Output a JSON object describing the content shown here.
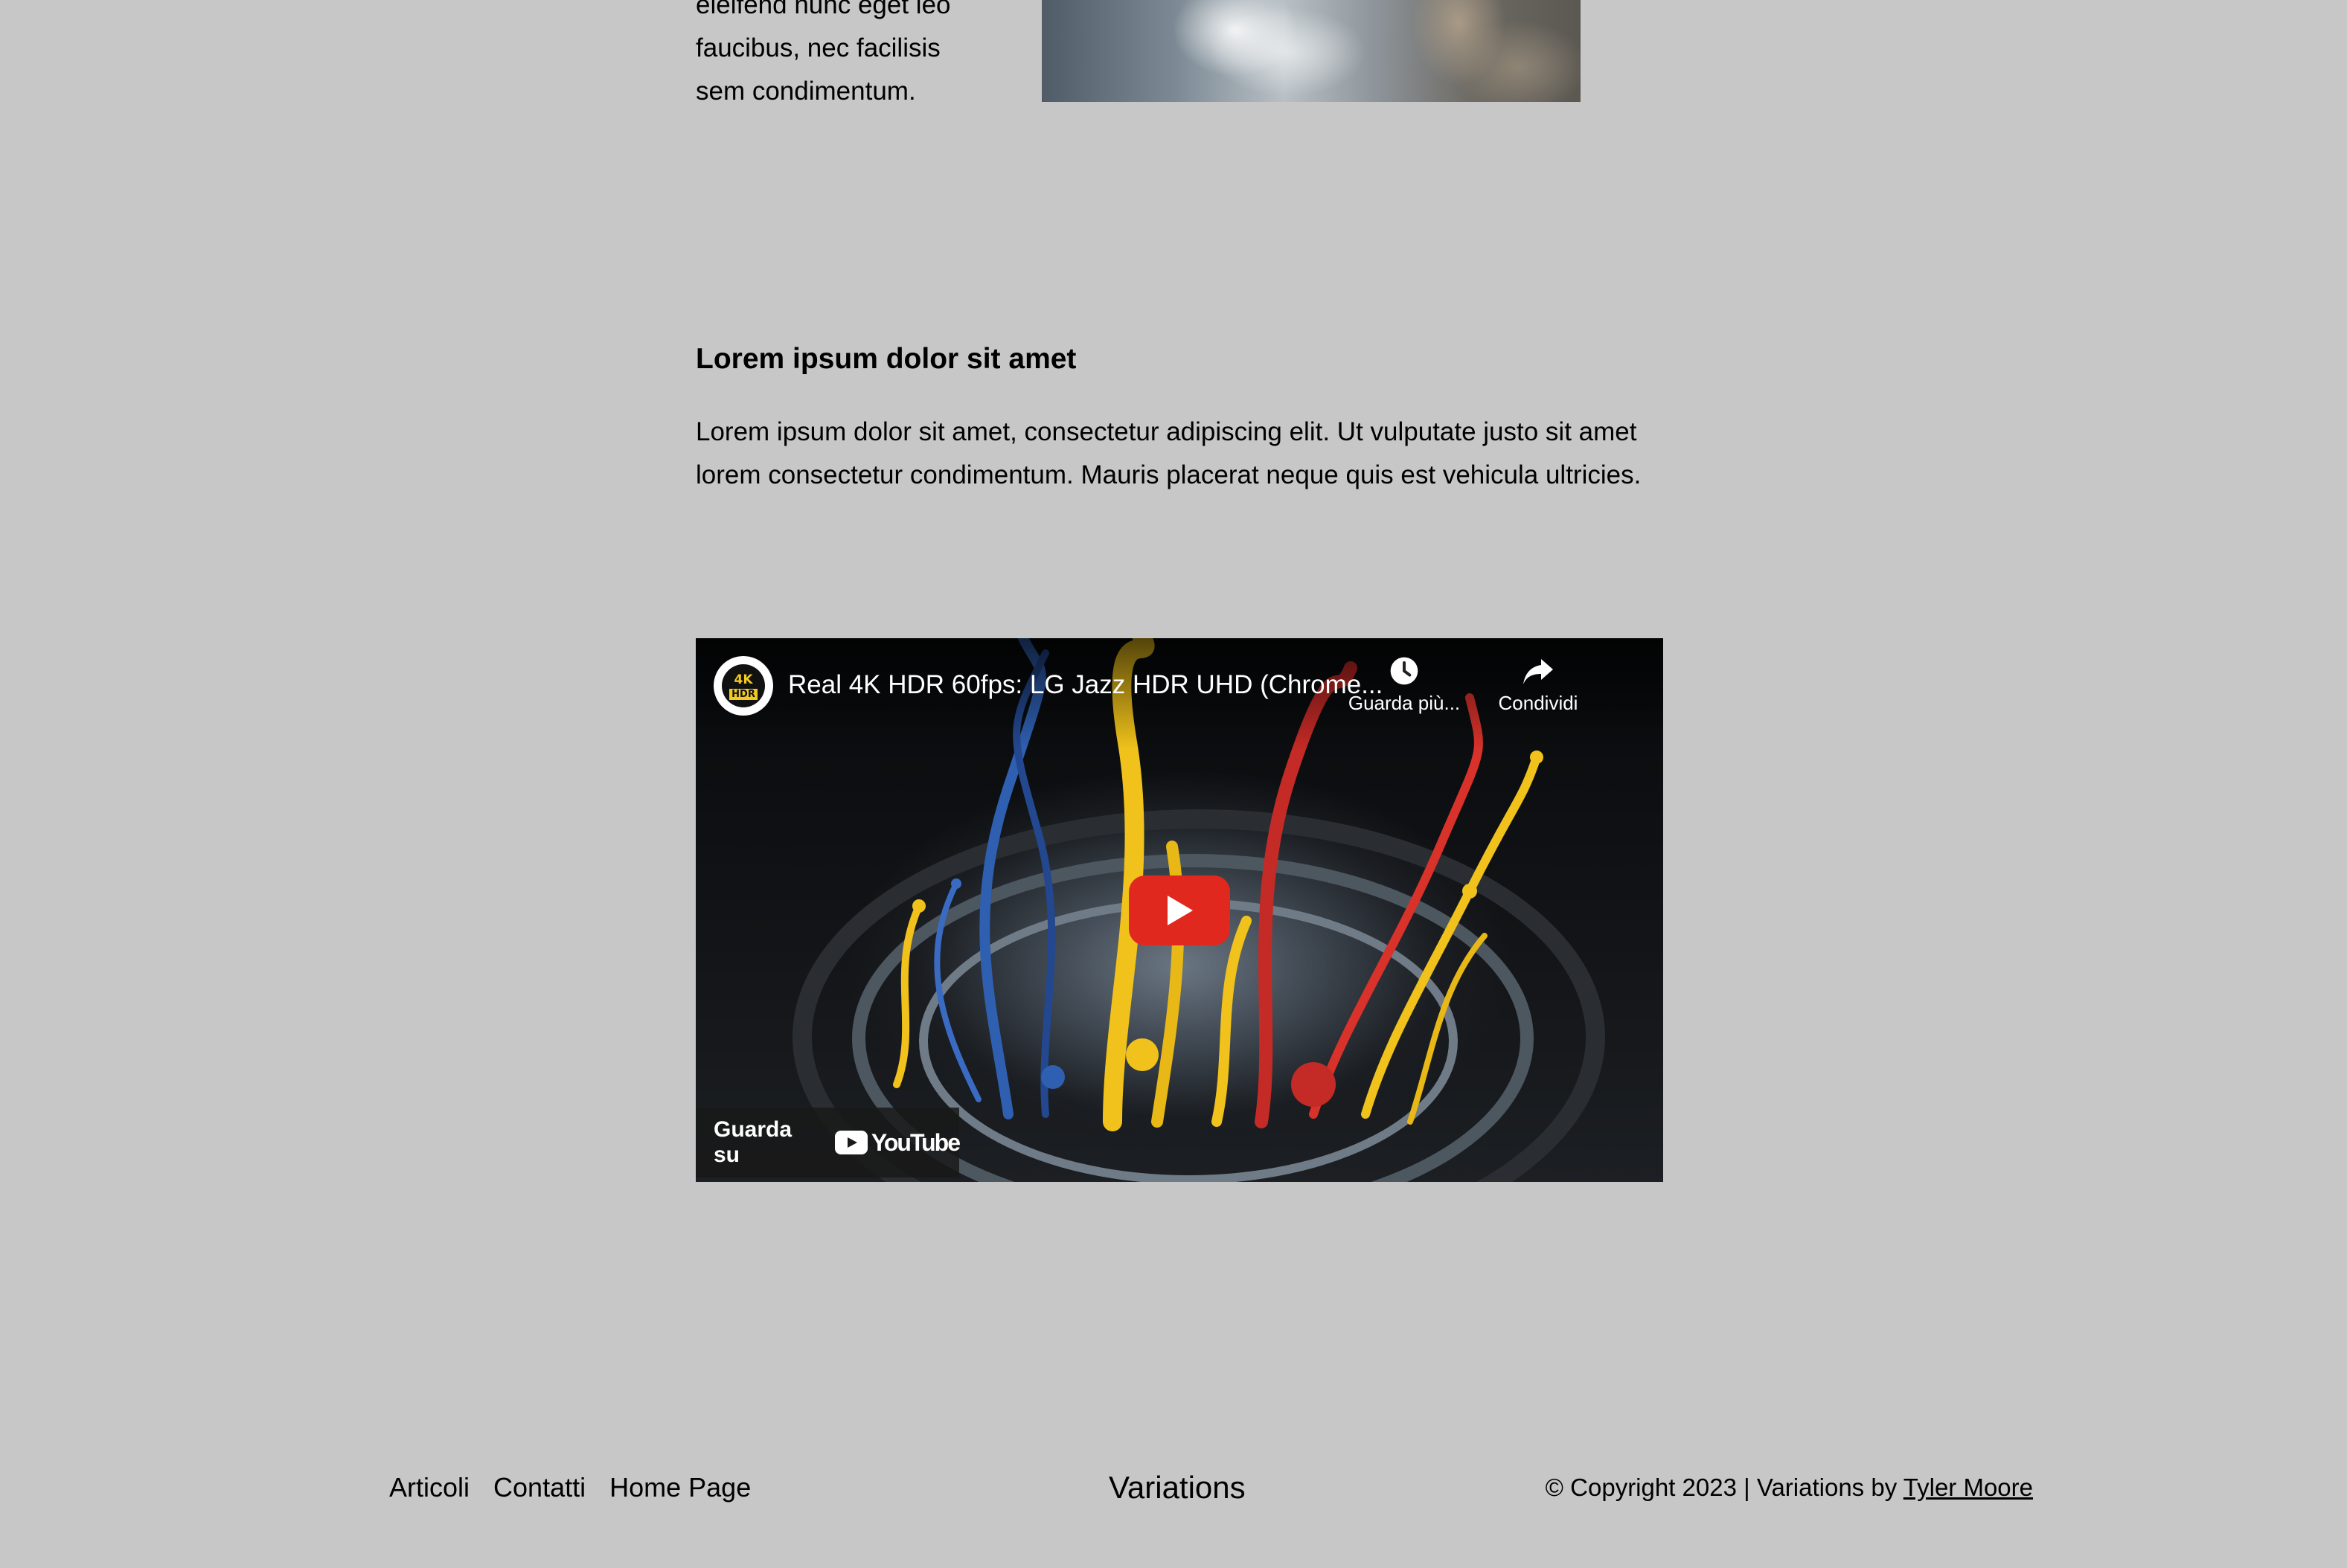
{
  "top": {
    "text_lines": [
      "eleifend nunc eget leo",
      "faucibus, nec facilisis",
      "sem condimentum."
    ]
  },
  "section": {
    "heading": "Lorem ipsum dolor sit amet",
    "body": "Lorem ipsum dolor sit amet, consectetur adipiscing elit. Ut vulputate justo sit amet lorem consectetur condimentum. Mauris placerat neque quis est vehicula ultricies."
  },
  "video": {
    "title": "Real 4K HDR 60fps: LG Jazz HDR UHD (Chrome...",
    "channel_logo_top": "4K",
    "channel_logo_bottom": "HDR",
    "watch_later_label": "Guarda più...",
    "share_label": "Condividi",
    "watch_on_label": "Guarda su",
    "youtube_wordmark": "YouTube",
    "play_button_color": "#e1281e"
  },
  "footer": {
    "nav": [
      "Articoli",
      "Contatti",
      "Home Page"
    ],
    "site_title": "Variations",
    "copyright_prefix": "© Copyright 2023 | Variations by",
    "author_link": "Tyler Moore"
  }
}
